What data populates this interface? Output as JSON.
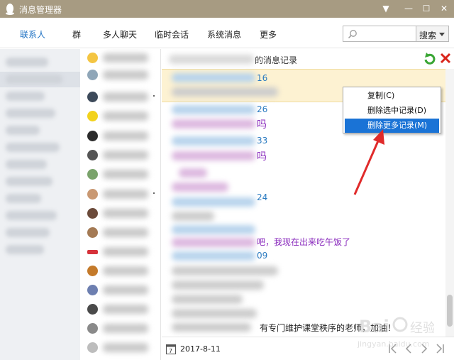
{
  "window": {
    "title": "消息管理器",
    "controls": [
      "▼",
      "—",
      "☐",
      "✕"
    ]
  },
  "nav": {
    "tabs": [
      "联系人",
      "群",
      "多人聊天",
      "临时会话",
      "系统消息",
      "更多"
    ],
    "active_tab": "联系人",
    "search_placeholder": "",
    "search_button": "搜索"
  },
  "messages": {
    "header_title": "的消息记录",
    "timestamps": [
      "16",
      "26",
      "33",
      "24",
      "09"
    ],
    "text_fragments": [
      "吗",
      "吗"
    ],
    "purple_line": "吧，我现在出来吃午饭了",
    "bottom_line": "有专门维护课堂秩序的老师，加油！"
  },
  "context_menu": {
    "items": [
      "复制(C)",
      "删除选中记录(D)",
      "删除更多记录(M)"
    ],
    "highlighted_index": 2
  },
  "footer": {
    "date": "2017-8-11"
  },
  "watermark": {
    "text": "jingyan.baidu.com",
    "brand": "Bai"
  },
  "colors": {
    "titlebar": "#a79b82",
    "accent_blue": "#1a6fc2",
    "timestamp_blue": "#2b7bc1",
    "purple_text": "#8a2bbd",
    "menu_highlight": "#1a73d6",
    "highlight_band": "#fdf2d2",
    "annotation_red": "#e02a2a"
  }
}
